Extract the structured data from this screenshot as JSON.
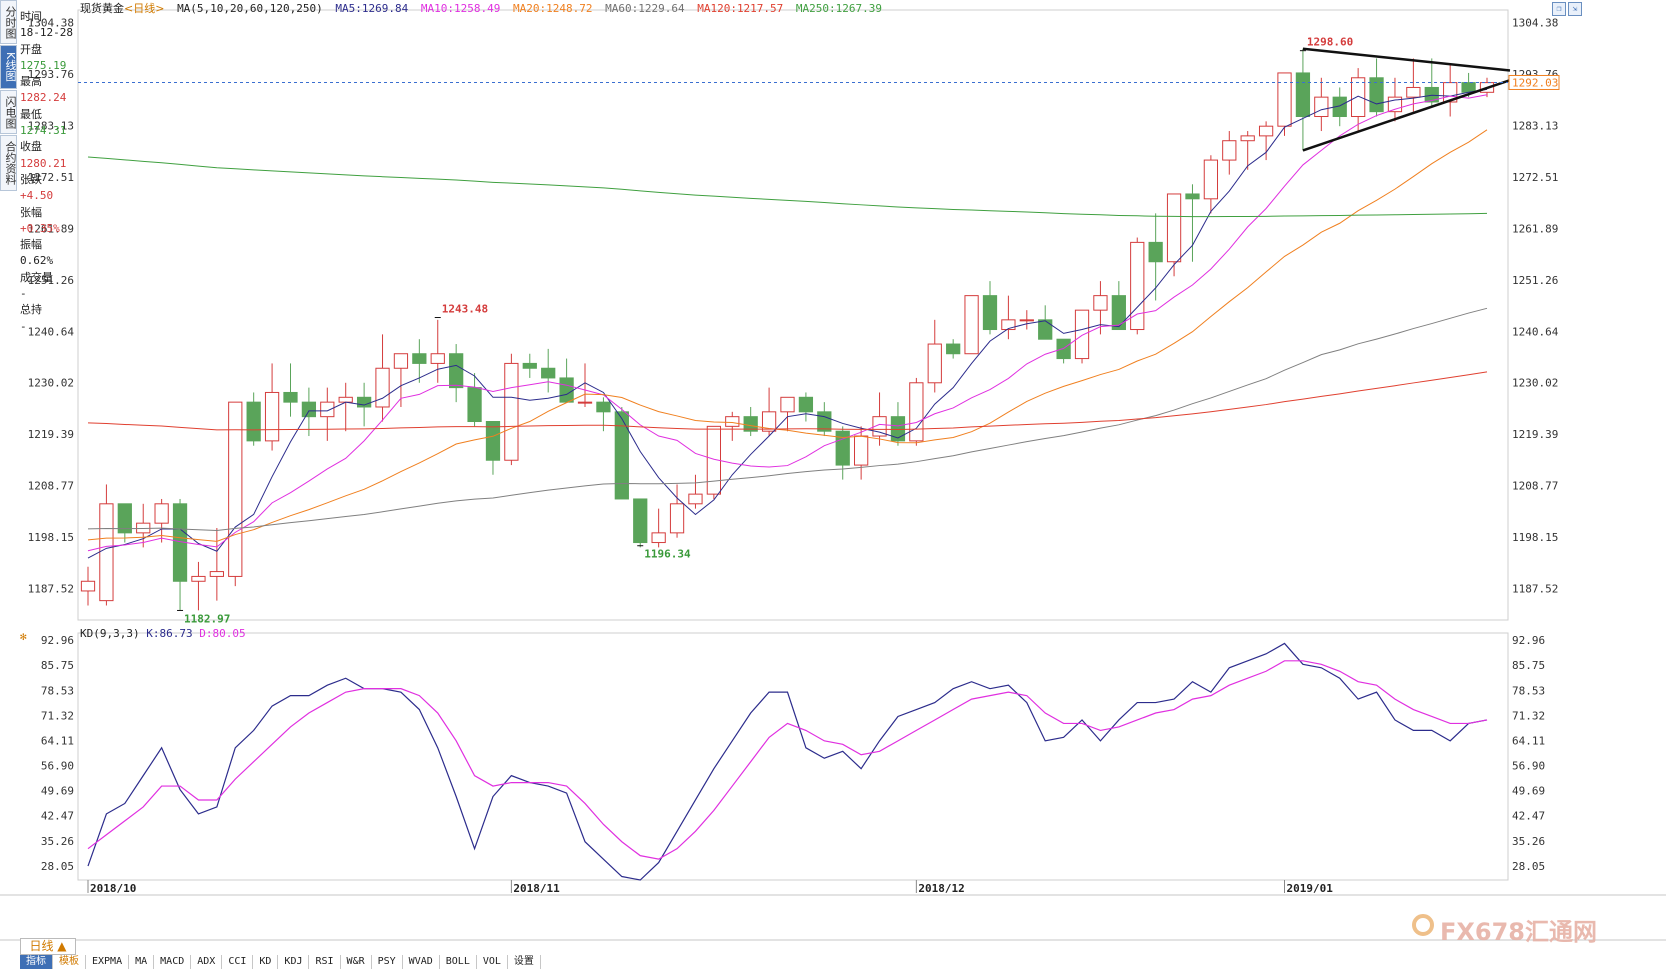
{
  "app": {
    "title": "现货黄金",
    "period_tag": "<日线>",
    "period_box": "日线"
  },
  "side_tabs": [
    {
      "label": "分时图",
      "active": false
    },
    {
      "label": "K线图",
      "active": true
    },
    {
      "label": "闪电图",
      "active": false
    },
    {
      "label": "合约资料",
      "active": false
    }
  ],
  "info_panel": {
    "time_label": "时间",
    "time_value": "18-12-28",
    "open_label": "开盘",
    "open_value": "1275.19",
    "high_label": "最高",
    "high_value": "1282.24",
    "low_label": "最低",
    "low_value": "1274.31",
    "close_label": "收盘",
    "close_value": "1280.21",
    "change_label": "张跌",
    "change_value": "+4.50",
    "pct_label": "张幅",
    "pct_value": "+0.35%",
    "amp_label": "振幅",
    "amp_value": "0.62%",
    "vol_label": "成交量",
    "vol_value": "-",
    "oi_label": "总持",
    "oi_value": "-"
  },
  "ma_legend": {
    "params": "MA(5,10,20,60,120,250)",
    "ma5": "MA5:1269.84",
    "ma10": "MA10:1258.49",
    "ma20": "MA20:1248.72",
    "ma60": "MA60:1229.64",
    "ma120": "MA120:1217.57",
    "ma250": "MA250:1267.39"
  },
  "kd_legend": {
    "params": "KD(9,3,3)",
    "k": "K:86.73",
    "d": "D:80.05"
  },
  "colors": {
    "up": "#d43c3c",
    "down": "#5aa45a",
    "ma5": "#2c2c8c",
    "ma10": "#e030e0",
    "ma20": "#f08020",
    "ma60": "#808080",
    "ma120": "#e04030",
    "ma250": "#40a040",
    "k": "#2c2c8c",
    "d": "#e030e0"
  },
  "tabs": [
    "指标",
    "模板",
    "EXPMA",
    "MA",
    "MACD",
    "ADX",
    "CCI",
    "KD",
    "KDJ",
    "RSI",
    "W&R",
    "PSY",
    "WVAD",
    "BOLL",
    "VOL",
    "设置"
  ],
  "watermark": "FX678汇通网",
  "chart_data": [
    {
      "type": "candlestick",
      "title": "现货黄金<日线>",
      "y_ticks": [
        1304.38,
        1293.76,
        1283.13,
        1272.51,
        1261.89,
        1251.26,
        1240.64,
        1230.02,
        1219.39,
        1208.77,
        1198.15,
        1187.52
      ],
      "y_range": [
        1181,
        1307
      ],
      "x_labels": [
        "2018/10",
        "2018/11",
        "2018/12",
        "2019/01"
      ],
      "current_price": "1292.03",
      "annotations": [
        "1298.60",
        "1243.48",
        "1196.34",
        "1182.97"
      ],
      "ohlc": [
        [
          1187,
          1192,
          1184,
          1189
        ],
        [
          1185,
          1209,
          1184,
          1205
        ],
        [
          1205,
          1203,
          1197,
          1199
        ],
        [
          1199,
          1205,
          1196,
          1201
        ],
        [
          1201,
          1206,
          1197,
          1205
        ],
        [
          1205,
          1206,
          1183,
          1189
        ],
        [
          1189,
          1193,
          1183,
          1190
        ],
        [
          1190,
          1200,
          1185,
          1191
        ],
        [
          1190,
          1226,
          1188,
          1226
        ],
        [
          1226,
          1228,
          1217,
          1218
        ],
        [
          1218,
          1234,
          1216,
          1228
        ],
        [
          1228,
          1234,
          1223,
          1226
        ],
        [
          1226,
          1229,
          1219,
          1223
        ],
        [
          1223,
          1229,
          1218,
          1226
        ],
        [
          1226,
          1230,
          1220,
          1227
        ],
        [
          1227,
          1230,
          1221,
          1225
        ],
        [
          1225,
          1240,
          1222,
          1233
        ],
        [
          1233,
          1236,
          1225,
          1236
        ],
        [
          1236,
          1239,
          1230,
          1234
        ],
        [
          1234,
          1243,
          1230,
          1236
        ],
        [
          1236,
          1238,
          1226,
          1229
        ],
        [
          1229,
          1232,
          1221,
          1222
        ],
        [
          1222,
          1222,
          1211,
          1214
        ],
        [
          1214,
          1236,
          1213,
          1234
        ],
        [
          1234,
          1236,
          1231,
          1233
        ],
        [
          1233,
          1237,
          1228,
          1231
        ],
        [
          1231,
          1235,
          1226,
          1226
        ],
        [
          1226,
          1234,
          1225,
          1226
        ],
        [
          1226,
          1227,
          1220,
          1224
        ],
        [
          1224,
          1225,
          1206,
          1206
        ],
        [
          1206,
          1206,
          1196,
          1197
        ],
        [
          1197,
          1204,
          1196,
          1199
        ],
        [
          1199,
          1209,
          1198,
          1205
        ],
        [
          1205,
          1211,
          1204,
          1207
        ],
        [
          1207,
          1221,
          1206,
          1221
        ],
        [
          1221,
          1224,
          1218,
          1223
        ],
        [
          1223,
          1225,
          1219,
          1220
        ],
        [
          1220,
          1229,
          1219,
          1224
        ],
        [
          1224,
          1227,
          1220,
          1227
        ],
        [
          1227,
          1228,
          1222,
          1224
        ],
        [
          1224,
          1226,
          1219,
          1220
        ],
        [
          1220,
          1221,
          1210,
          1213
        ],
        [
          1213,
          1221,
          1210,
          1219
        ],
        [
          1219,
          1228,
          1217,
          1223
        ],
        [
          1223,
          1226,
          1217,
          1218
        ],
        [
          1218,
          1231,
          1217,
          1230
        ],
        [
          1230,
          1243,
          1228,
          1238
        ],
        [
          1238,
          1239,
          1235,
          1236
        ],
        [
          1236,
          1248,
          1236,
          1248
        ],
        [
          1248,
          1251,
          1240,
          1241
        ],
        [
          1241,
          1248,
          1239,
          1243
        ],
        [
          1243,
          1245,
          1241,
          1243
        ],
        [
          1243,
          1246,
          1239,
          1239
        ],
        [
          1239,
          1239,
          1234,
          1235
        ],
        [
          1235,
          1245,
          1234,
          1245
        ],
        [
          1245,
          1251,
          1240,
          1248
        ],
        [
          1248,
          1251,
          1241,
          1241
        ],
        [
          1241,
          1260,
          1240,
          1259
        ],
        [
          1259,
          1265,
          1247,
          1255
        ],
        [
          1255,
          1269,
          1252,
          1269
        ],
        [
          1269,
          1271,
          1255,
          1268
        ],
        [
          1268,
          1277,
          1265,
          1276
        ],
        [
          1276,
          1282,
          1273,
          1280
        ],
        [
          1280,
          1282,
          1274,
          1281
        ],
        [
          1281,
          1284,
          1276,
          1283
        ],
        [
          1283,
          1294,
          1281,
          1294
        ],
        [
          1294,
          1299,
          1278,
          1285
        ],
        [
          1285,
          1293,
          1282,
          1289
        ],
        [
          1289,
          1291,
          1283,
          1285
        ],
        [
          1285,
          1295,
          1282,
          1293
        ],
        [
          1293,
          1297,
          1285,
          1286
        ],
        [
          1286,
          1293,
          1284,
          1289
        ],
        [
          1289,
          1297,
          1286,
          1291
        ],
        [
          1291,
          1297,
          1287,
          1288
        ],
        [
          1288,
          1296,
          1285,
          1292
        ],
        [
          1292,
          1294,
          1289,
          1290
        ],
        [
          1290,
          1293,
          1289,
          1292
        ]
      ]
    },
    {
      "type": "line",
      "title": "KD(9,3,3)",
      "y_ticks": [
        92.96,
        85.75,
        78.53,
        71.32,
        64.11,
        56.9,
        49.69,
        42.47,
        35.26,
        28.05
      ],
      "y_range": [
        24,
        95
      ],
      "x_labels": [
        "2018/10",
        "2018/11",
        "2018/12",
        "2019/01"
      ],
      "series": [
        {
          "name": "K",
          "values": [
            28,
            43,
            46,
            54,
            62,
            50,
            43,
            45,
            62,
            67,
            74,
            77,
            77,
            80,
            82,
            79,
            79,
            78,
            73,
            62,
            48,
            33,
            48,
            54,
            52,
            51,
            49,
            35,
            30,
            25,
            24,
            29,
            38,
            47,
            56,
            64,
            72,
            78,
            78,
            62,
            59,
            61,
            56,
            64,
            71,
            73,
            75,
            79,
            81,
            79,
            80,
            75,
            64,
            65,
            70,
            64,
            70,
            75,
            75,
            76,
            81,
            78,
            85,
            87,
            89,
            92,
            86,
            85,
            82,
            76,
            78,
            70,
            67,
            67,
            64,
            69,
            70
          ]
        },
        {
          "name": "D",
          "values": [
            33,
            37,
            41,
            45,
            51,
            51,
            47,
            47,
            53,
            58,
            63,
            68,
            72,
            75,
            78,
            79,
            79,
            79,
            77,
            72,
            64,
            54,
            51,
            52,
            52,
            52,
            51,
            46,
            40,
            35,
            31,
            30,
            33,
            38,
            44,
            51,
            58,
            65,
            69,
            67,
            64,
            63,
            60,
            61,
            64,
            67,
            70,
            73,
            76,
            77,
            78,
            77,
            72,
            69,
            69,
            67,
            68,
            70,
            72,
            73,
            76,
            77,
            80,
            82,
            84,
            87,
            87,
            86,
            84,
            81,
            80,
            76,
            73,
            71,
            69,
            69,
            70
          ]
        }
      ]
    }
  ]
}
